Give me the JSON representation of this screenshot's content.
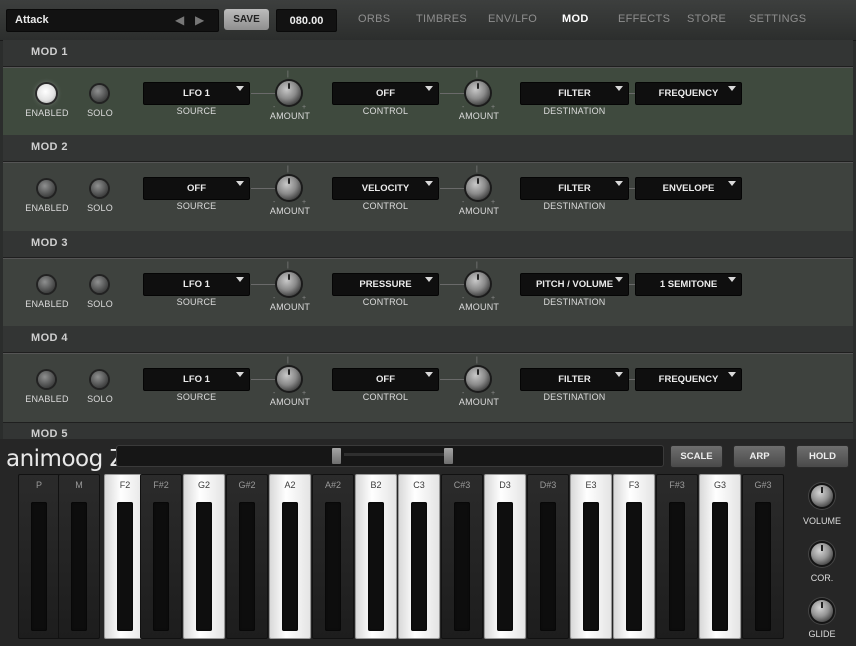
{
  "topbar": {
    "preset_name": "Attack",
    "prev_arrow": "◀",
    "next_arrow": "▶",
    "save_label": "SAVE",
    "tempo_value": "080.00",
    "tabs": [
      "ORBS",
      "TIMBRES",
      "ENV/LFO",
      "MOD",
      "EFFECTS",
      "STORE",
      "SETTINGS"
    ],
    "active_tab": "MOD"
  },
  "mods": [
    {
      "title": "MOD 1",
      "enabled_label": "ENABLED",
      "solo_label": "SOLO",
      "enabled": true,
      "source": "LFO 1",
      "source_label": "SOURCE",
      "amount_label_1": "AMOUNT",
      "control": "OFF",
      "control_label": "CONTROL",
      "amount_label_2": "AMOUNT",
      "destination": "FILTER",
      "destination_label": "DESTINATION",
      "target": "FREQUENCY"
    },
    {
      "title": "MOD 2",
      "enabled_label": "ENABLED",
      "solo_label": "SOLO",
      "enabled": false,
      "source": "OFF",
      "source_label": "SOURCE",
      "amount_label_1": "AMOUNT",
      "control": "VELOCITY",
      "control_label": "CONTROL",
      "amount_label_2": "AMOUNT",
      "destination": "FILTER",
      "destination_label": "DESTINATION",
      "target": "ENVELOPE"
    },
    {
      "title": "MOD 3",
      "enabled_label": "ENABLED",
      "solo_label": "SOLO",
      "enabled": false,
      "source": "LFO 1",
      "source_label": "SOURCE",
      "amount_label_1": "AMOUNT",
      "control": "PRESSURE",
      "control_label": "CONTROL",
      "amount_label_2": "AMOUNT",
      "destination": "PITCH / VOLUME",
      "destination_label": "DESTINATION",
      "target": "1 SEMITONE"
    },
    {
      "title": "MOD 4",
      "enabled_label": "ENABLED",
      "solo_label": "SOLO",
      "enabled": false,
      "source": "LFO 1",
      "source_label": "SOURCE",
      "amount_label_1": "AMOUNT",
      "control": "OFF",
      "control_label": "CONTROL",
      "amount_label_2": "AMOUNT",
      "destination": "FILTER",
      "destination_label": "DESTINATION",
      "target": "FREQUENCY"
    }
  ],
  "mod5_title": "MOD 5",
  "knob_marks": {
    "min": "-",
    "max": "+",
    "center": "|"
  },
  "keyboard": {
    "logo": "animoog Z",
    "buttons": [
      "SCALE",
      "ARP",
      "HOLD"
    ],
    "keys": [
      {
        "label": "P",
        "light": false
      },
      {
        "label": "M",
        "light": false
      },
      {
        "label": "F2",
        "light": true
      },
      {
        "label": "F#2",
        "light": false
      },
      {
        "label": "G2",
        "light": true
      },
      {
        "label": "G#2",
        "light": false
      },
      {
        "label": "A2",
        "light": true
      },
      {
        "label": "A#2",
        "light": false
      },
      {
        "label": "B2",
        "light": true
      },
      {
        "label": "C3",
        "light": true
      },
      {
        "label": "C#3",
        "light": false
      },
      {
        "label": "D3",
        "light": true
      },
      {
        "label": "D#3",
        "light": false
      },
      {
        "label": "E3",
        "light": true
      },
      {
        "label": "F3",
        "light": true
      },
      {
        "label": "F#3",
        "light": false
      },
      {
        "label": "G3",
        "light": true
      },
      {
        "label": "G#3",
        "light": false
      }
    ],
    "right_knobs": [
      "VOLUME",
      "COR.",
      "GLIDE"
    ]
  }
}
